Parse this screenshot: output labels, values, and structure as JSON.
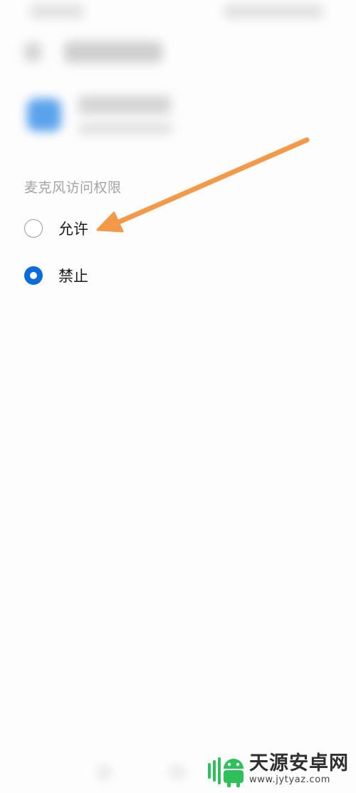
{
  "permission_section": {
    "title": "麦克风访问权限",
    "options": [
      {
        "label": "允许",
        "selected": false
      },
      {
        "label": "禁止",
        "selected": true
      }
    ]
  },
  "annotation": {
    "color": "#f39a4a"
  },
  "colors": {
    "radio_selected": "#0a6bd9",
    "app_icon": "#5aa3ec"
  },
  "watermark": {
    "title": "天源安卓网",
    "url": "www.jytyaz.com",
    "logo_icon": "android-robot-icon"
  }
}
